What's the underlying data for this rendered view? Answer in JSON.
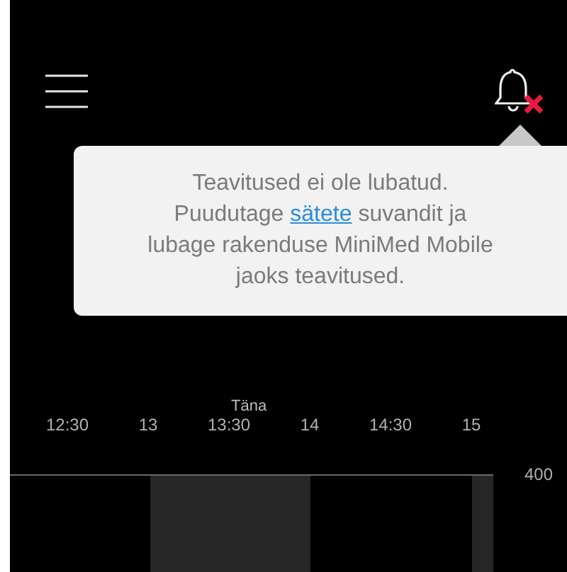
{
  "popup": {
    "before": "Teavitused ei ole lubatud.\nPuudutage ",
    "link": "sätete",
    "after": " suvandit ja lubage rakenduse MiniMed Mobile jaoks teavitused."
  },
  "timeline": {
    "day_label": "Täna",
    "ticks": [
      "12:30",
      "13",
      "13:30",
      "14",
      "14:30",
      "15"
    ],
    "y_label": "400"
  }
}
